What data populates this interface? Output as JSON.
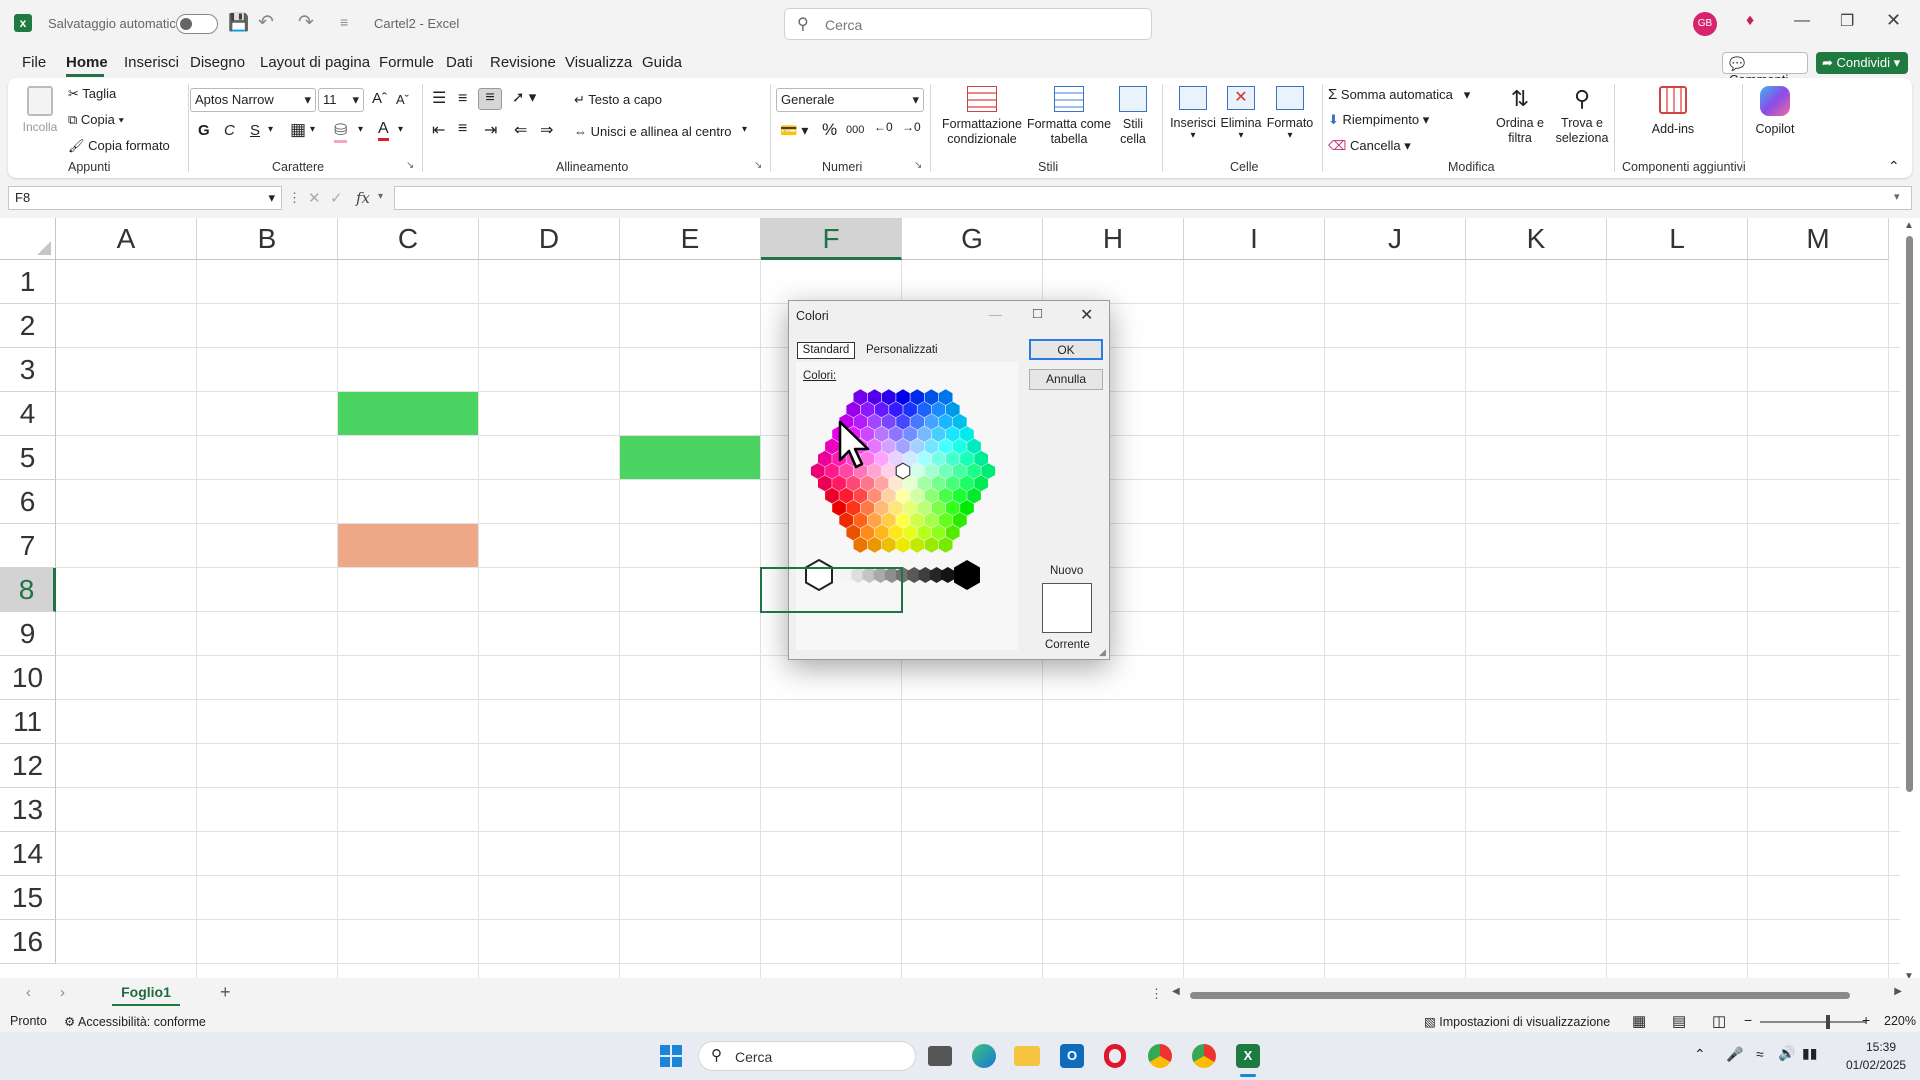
{
  "title": {
    "autosave_label": "Salvataggio automatico",
    "doc_name": "Cartel2",
    "app_name": "Excel",
    "search_placeholder": "Cerca",
    "avatar": "GB"
  },
  "menu": [
    "File",
    "Home",
    "Inserisci",
    "Disegno",
    "Layout di pagina",
    "Formule",
    "Dati",
    "Revisione",
    "Visualizza",
    "Guida"
  ],
  "menu_right": {
    "comments": "Commenti",
    "share": "Condividi"
  },
  "ribbon": {
    "paste": "Incolla",
    "cut": "Taglia",
    "copy": "Copia",
    "format_painter": "Copia formato",
    "group_clipboard": "Appunti",
    "font_name": "Aptos Narrow",
    "font_size": "11",
    "bold": "G",
    "italic": "C",
    "underline": "S",
    "group_font": "Carattere",
    "wrap_text": "Testo a capo",
    "merge_center": "Unisci e allinea al centro",
    "group_alignment": "Allineamento",
    "number_format": "Generale",
    "group_number": "Numeri",
    "cond_format": "Formattazione condizionale",
    "format_table": "Formatta come tabella",
    "cell_styles": "Stili cella",
    "group_styles": "Stili",
    "insert": "Inserisci",
    "delete": "Elimina",
    "format": "Formato",
    "group_cells": "Celle",
    "autosum": "Somma automatica",
    "fill": "Riempimento",
    "clear": "Cancella",
    "sort_filter": "Ordina e filtra",
    "find_select": "Trova e seleziona",
    "group_editing": "Modifica",
    "addins": "Add-ins",
    "group_addins": "Componenti aggiuntivi",
    "copilot": "Copilot"
  },
  "formula_bar": {
    "name_box": "F8",
    "fx": "fx",
    "value": ""
  },
  "columns": [
    "A",
    "B",
    "C",
    "D",
    "E",
    "F",
    "G",
    "H",
    "I",
    "J",
    "K",
    "L",
    "M"
  ],
  "rows": [
    "1",
    "2",
    "3",
    "4",
    "5",
    "6",
    "7",
    "8",
    "9",
    "10",
    "11",
    "12",
    "13",
    "14",
    "15",
    "16"
  ],
  "selected_cell": "F8",
  "filled_cells": [
    {
      "cell": "C4",
      "color": "#4cd463"
    },
    {
      "cell": "E5",
      "color": "#4cd463"
    },
    {
      "cell": "C7",
      "color": "#eda887"
    }
  ],
  "sheet_tabs": [
    "Foglio1"
  ],
  "status": {
    "ready": "Pronto",
    "accessibility": "Accessibilità: conforme",
    "display_settings": "Impostazioni di visualizzazione",
    "zoom": "220%"
  },
  "taskbar": {
    "search": "Cerca",
    "time": "15:39",
    "date": "01/02/2025"
  },
  "dialog": {
    "title": "Colori",
    "tab_standard": "Standard",
    "tab_custom": "Personalizzati",
    "colors_label": "Colori:",
    "ok": "OK",
    "cancel": "Annulla",
    "new_label": "Nuovo",
    "current_label": "Corrente"
  },
  "colors": {
    "accent": "#217346",
    "share_bg": "#1f7a3f"
  }
}
